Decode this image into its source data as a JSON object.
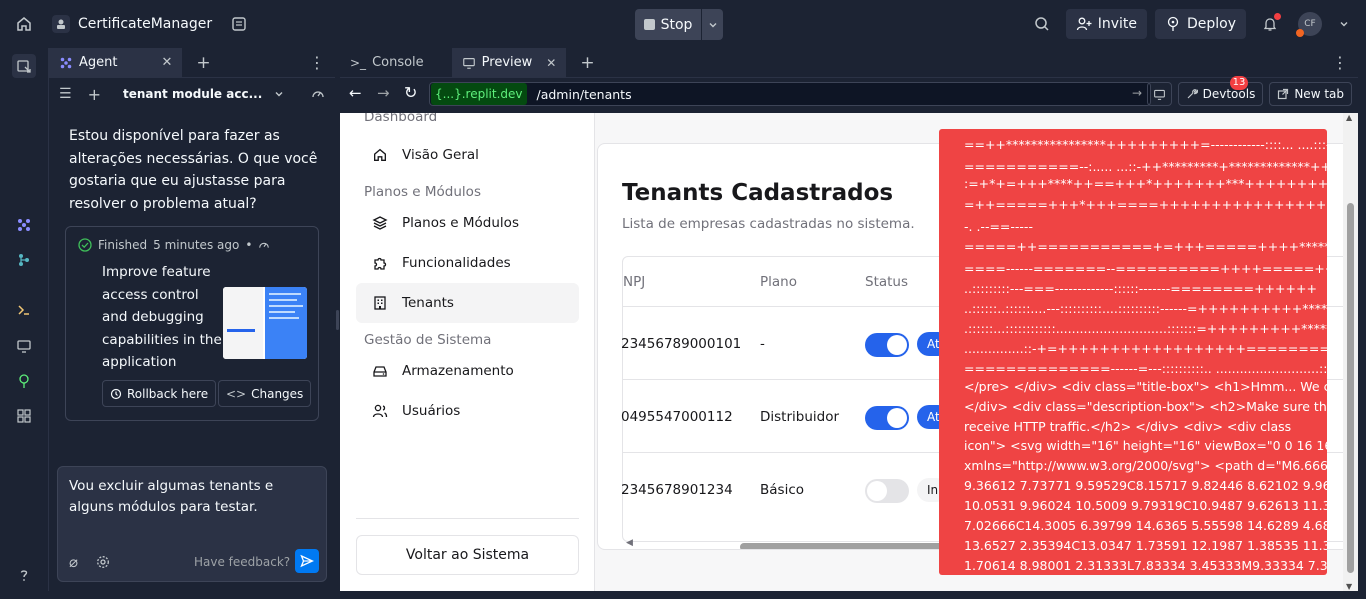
{
  "topbar": {
    "app_name": "CertificateManager",
    "stop_label": "Stop",
    "invite_label": "Invite",
    "deploy_label": "Deploy",
    "avatar_initials": "CF"
  },
  "agent": {
    "tab_label": "Agent",
    "thread_title": "tenant module acc...",
    "message": "Estou disponível para fazer as alterações necessárias. O que você gostaria que eu ajustasse para resolver o problema atual?",
    "card": {
      "status": "Finished",
      "time": "5 minutes ago",
      "title": "Improve feature access control and debugging capabilities in the application",
      "rollback_label": "Rollback here",
      "changes_label": "Changes"
    },
    "composer_text": "Vou excluir algumas tenants e alguns módulos para testar.",
    "feedback_label": "Have feedback?"
  },
  "preview": {
    "tabs": [
      {
        "label": "Console"
      },
      {
        "label": "Preview"
      }
    ],
    "domain": "{...}.replit.dev",
    "path": "/admin/tenants",
    "devtools_label": "Devtools",
    "devtools_badge": "13",
    "newtab_label": "New tab"
  },
  "app": {
    "sidebar": {
      "top_label": "Dashboard",
      "group1_items": [
        {
          "label": "Visão Geral"
        }
      ],
      "group2_label": "Planos e Módulos",
      "group2_items": [
        {
          "label": "Planos e Módulos"
        },
        {
          "label": "Funcionalidades"
        },
        {
          "label": "Tenants"
        }
      ],
      "group3_label": "Gestão de Sistema",
      "group3_items": [
        {
          "label": "Armazenamento"
        },
        {
          "label": "Usuários"
        }
      ],
      "back_label": "Voltar ao Sistema"
    },
    "main": {
      "title": "Tenants Cadastrados",
      "subtitle": "Lista de empresas cadastradas no sistema.",
      "columns": [
        "NPJ",
        "Plano",
        "Status"
      ],
      "rows": [
        {
          "cnpj": "23456789000101",
          "plan": "-",
          "enabled": true,
          "status": "At"
        },
        {
          "cnpj": "0495547000112",
          "plan": "Distribuidor",
          "enabled": true,
          "status": "At"
        },
        {
          "cnpj": "2345678901234",
          "plan": "Básico",
          "enabled": false,
          "status": "In"
        }
      ]
    },
    "error_overlay": {
      "lines": [
        "==++****************+++++++++=------------::::... ....:::-=",
        "===========--:..... ...::-++*********+*************+++++",
        ":=+*+=+++****++==+++*+++++++***++++++++***",
        "=++=====+++*+++====+++++++++++++++++=",
        "-. .--==-----",
        "=====++===========+=+++=====++++*******",
        "====------=======--==========++++=====++++",
        "..:::::::::---===-------------::::::-------========++++++",
        "..::::::..::::::....---::::::::::....::::::::::------=++++++++++****+++++++",
        ".::::::...::::::::::::............................:::::::=+++++++++*****++++++=====",
        "...............::-+=++++++++++++++++++=============-----",
        "==============------=---::::::::::.. ..........................:::::::::::-----",
        "</pre> </div> <div class=\"title-box\"> <h1>Hmm... We co",
        "</div> <div class=\"description-box\"> <h2>Make sure this",
        "receive HTTP traffic.</h2> </div> <div> <div class",
        "icon\"> <svg width=\"16\" height=\"16\" viewBox=\"0 0 16 16\"",
        "xmlns=\"http://www.w3.org/2000/svg\"> <path d=\"M6.6666",
        "9.36612 7.73771 9.59529C8.15717 9.82446 8.62102 9.96074",
        "10.0531 9.96024 10.5009 9.79319C10.9487 9.62613 11.3554",
        "7.02666C14.3005 6.39799 14.6365 5.55598 14.6289 4.68199",
        "13.6527 2.35394C13.0347 1.73591 12.1987 1.38535 11.3247",
        "1.70614 8.98001 2.31333L7.83334 3.45333M9.33334 7.3333"
      ]
    }
  },
  "colors": {
    "accent": "#0079f2",
    "toggle_on": "#2563eb",
    "error_bg": "#ef4444"
  }
}
